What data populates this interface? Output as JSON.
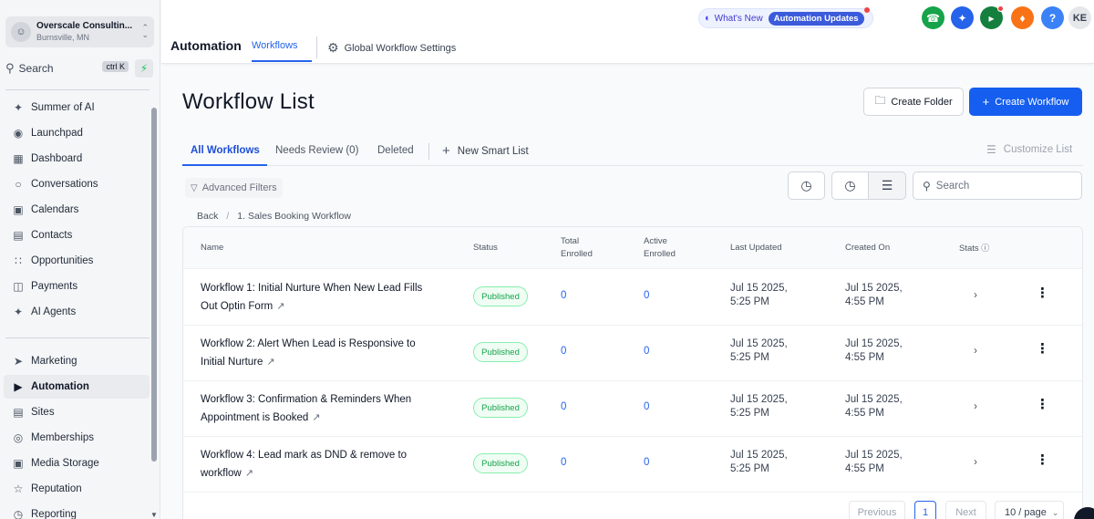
{
  "sidebar": {
    "account": {
      "name": "Overscale Consultin...",
      "location": "Burnsville, MN"
    },
    "search": {
      "label": "Search",
      "shortcut": "ctrl K"
    },
    "items": [
      {
        "label": "Summer of AI",
        "icon": "sparkle-icon"
      },
      {
        "label": "Launchpad",
        "icon": "launchpad-icon"
      },
      {
        "label": "Dashboard",
        "icon": "dashboard-icon"
      },
      {
        "label": "Conversations",
        "icon": "chat-icon"
      },
      {
        "label": "Calendars",
        "icon": "calendar-icon"
      },
      {
        "label": "Contacts",
        "icon": "contacts-icon"
      },
      {
        "label": "Opportunities",
        "icon": "opportunities-icon"
      },
      {
        "label": "Payments",
        "icon": "payments-icon"
      },
      {
        "label": "AI Agents",
        "icon": "ai-agents-icon"
      },
      {
        "label": "Marketing",
        "icon": "marketing-icon"
      },
      {
        "label": "Automation",
        "icon": "automation-icon"
      },
      {
        "label": "Sites",
        "icon": "sites-icon"
      },
      {
        "label": "Memberships",
        "icon": "memberships-icon"
      },
      {
        "label": "Media Storage",
        "icon": "media-storage-icon"
      },
      {
        "label": "Reputation",
        "icon": "star-icon"
      },
      {
        "label": "Reporting",
        "icon": "reporting-icon"
      }
    ],
    "active": "Automation"
  },
  "header": {
    "title": "Automation",
    "tabs": {
      "workflows": "Workflows",
      "global_settings": "Global Workflow Settings"
    },
    "whats_new": {
      "label": "What's New",
      "pill": "Automation Updates"
    },
    "avatar_initials": "KE",
    "help_label": "?",
    "colors": {
      "phone": "#16a34a",
      "ai": "#2563eb",
      "announce": "#15803d",
      "bell": "#f97316",
      "help": "#3b82f6",
      "avatar": "#e5e7eb"
    }
  },
  "main": {
    "page_title": "Workflow List",
    "create_folder": "Create Folder",
    "create_workflow": "Create Workflow",
    "tabs": [
      {
        "label": "All Workflows",
        "selected": true
      },
      {
        "label": "Needs Review (0)",
        "selected": false
      },
      {
        "label": "Deleted",
        "selected": false
      }
    ],
    "new_smart_list": "New Smart List",
    "customize_list": "Customize List",
    "advanced_filters": "Advanced Filters",
    "search_placeholder": "Search",
    "breadcrumb": {
      "back": "Back",
      "current": "1. Sales Booking Workflow"
    },
    "table": {
      "headers": {
        "name": "Name",
        "status": "Status",
        "total_enrolled_1": "Total",
        "total_enrolled_2": "Enrolled",
        "active_enrolled_1": "Active",
        "active_enrolled_2": "Enrolled",
        "last_updated": "Last Updated",
        "created_on": "Created On",
        "stats": "Stats"
      },
      "rows": [
        {
          "name_1": "Workflow 1: Initial Nurture When New Lead Fills",
          "name_2": "Out Optin Form",
          "status": "Published",
          "total": "0",
          "active": "0",
          "updated_1": "Jul 15 2025,",
          "updated_2": "5:25 PM",
          "created_1": "Jul 15 2025,",
          "created_2": "4:55 PM"
        },
        {
          "name_1": "Workflow 2: Alert When Lead is Responsive to",
          "name_2": "Initial Nurture",
          "status": "Published",
          "total": "0",
          "active": "0",
          "updated_1": "Jul 15 2025,",
          "updated_2": "5:25 PM",
          "created_1": "Jul 15 2025,",
          "created_2": "4:55 PM"
        },
        {
          "name_1": "Workflow 3: Confirmation & Reminders When",
          "name_2": "Appointment is Booked",
          "status": "Published",
          "total": "0",
          "active": "0",
          "updated_1": "Jul 15 2025,",
          "updated_2": "5:25 PM",
          "created_1": "Jul 15 2025,",
          "created_2": "4:55 PM"
        },
        {
          "name_1": "Workflow 4: Lead mark as DND & remove to",
          "name_2": "workflow",
          "status": "Published",
          "total": "0",
          "active": "0",
          "updated_1": "Jul 15 2025,",
          "updated_2": "5:25 PM",
          "created_1": "Jul 15 2025,",
          "created_2": "4:55 PM"
        }
      ]
    },
    "pagination": {
      "previous": "Previous",
      "current_page": "1",
      "next": "Next",
      "per_page": "10 / page"
    }
  }
}
